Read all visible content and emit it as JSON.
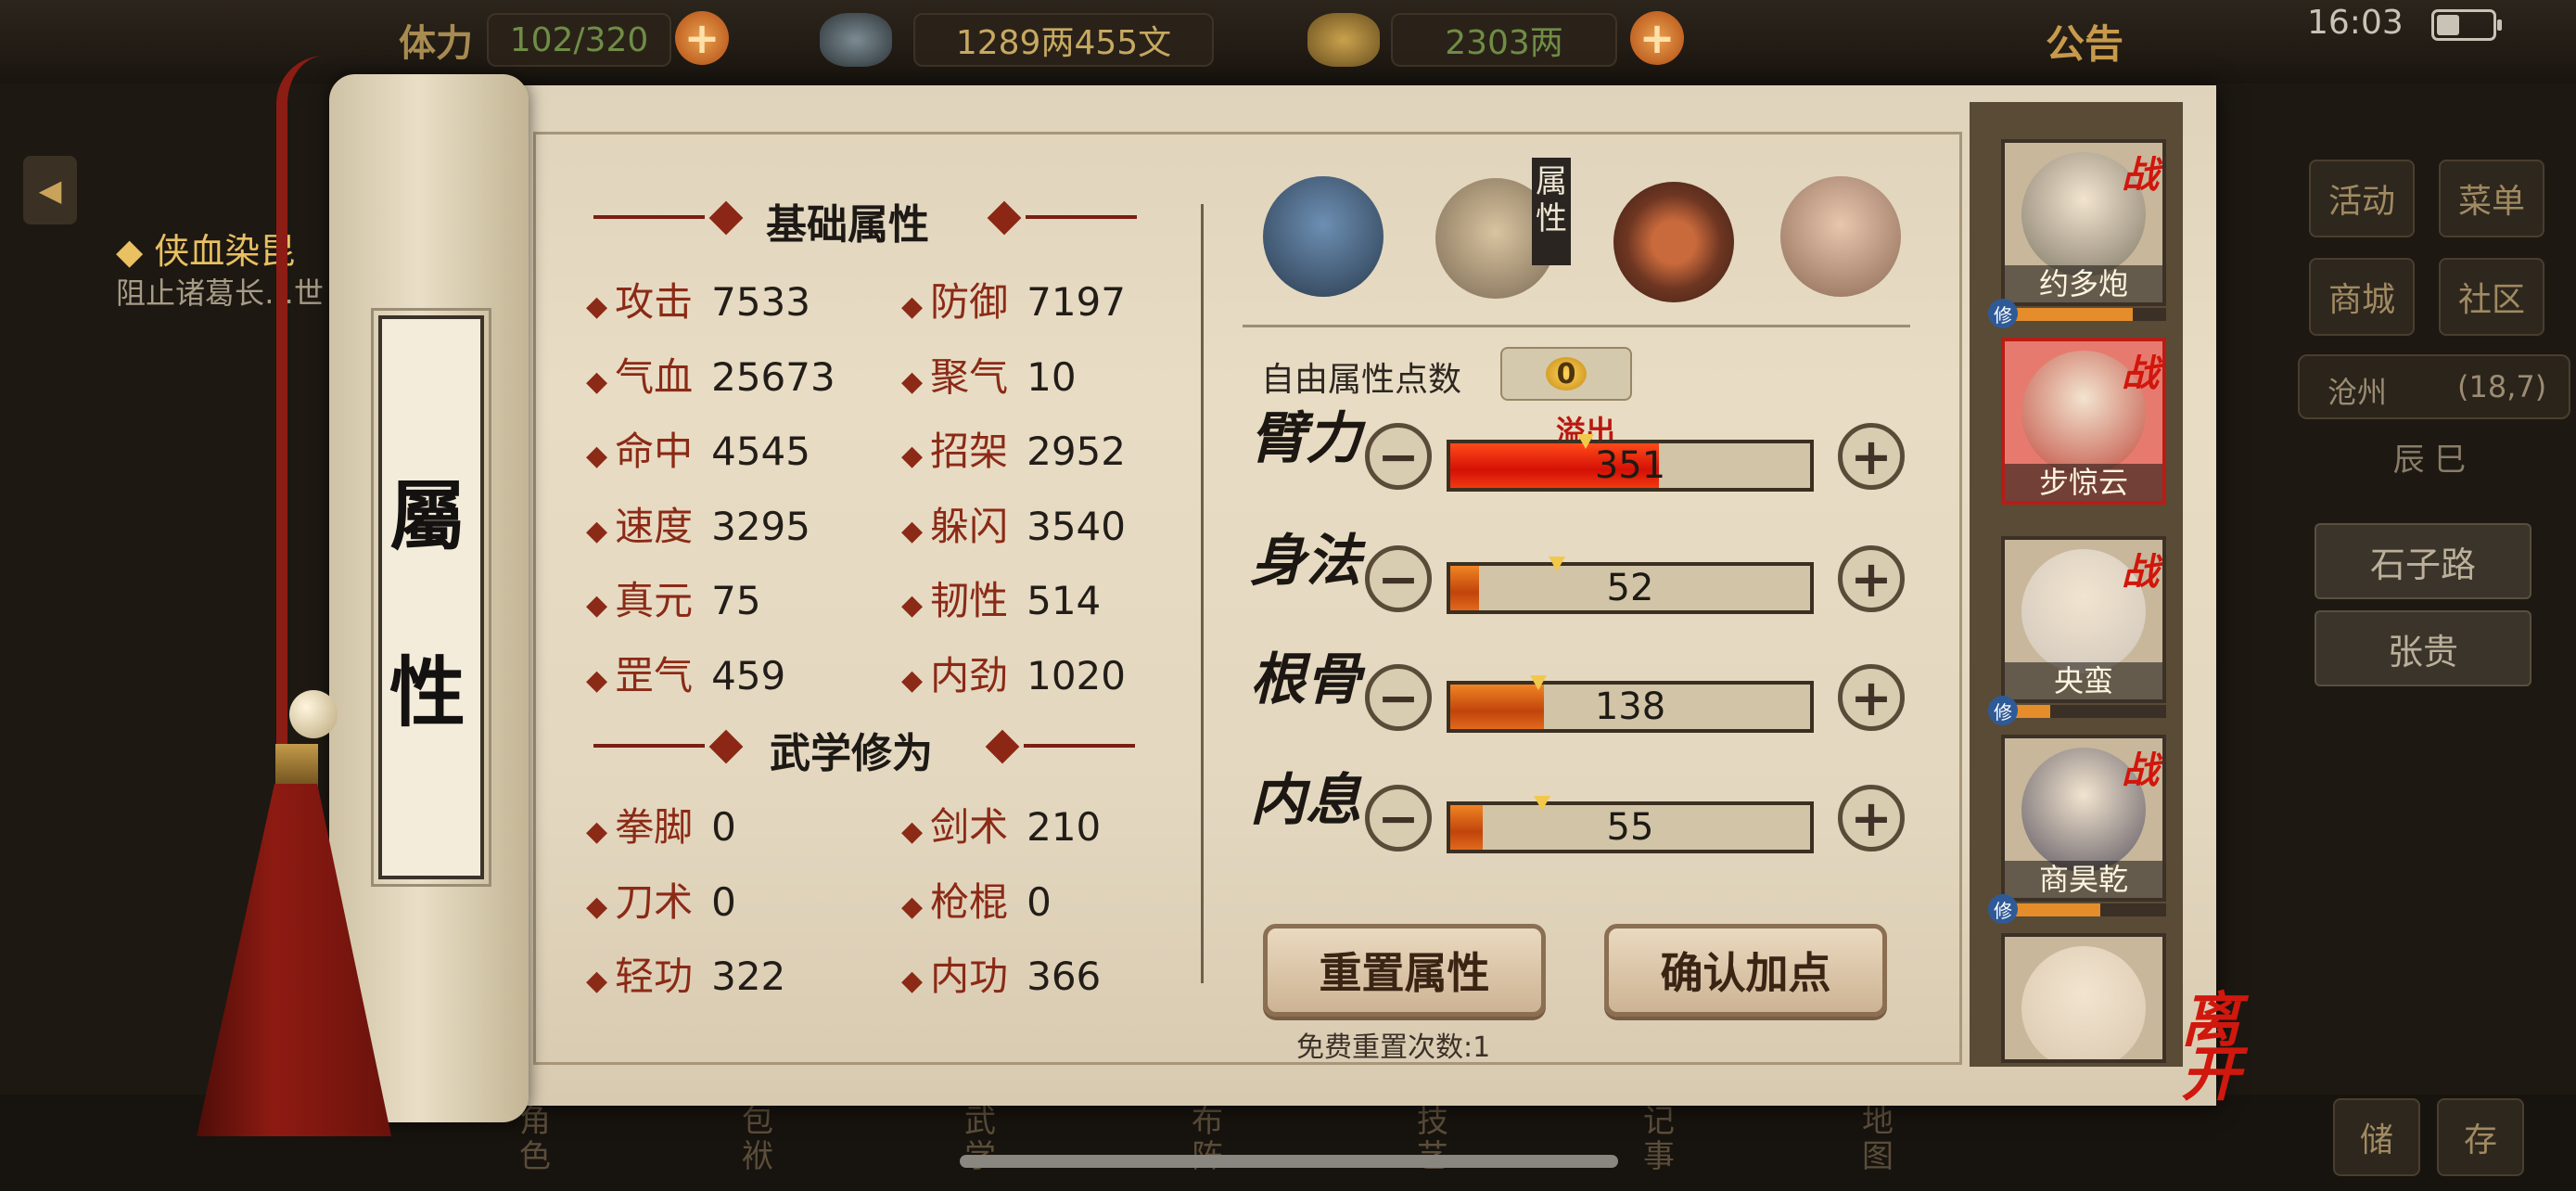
{
  "hud": {
    "stamina_label": "体力",
    "stamina_value": "102/320",
    "silver": "1289两455文",
    "gold": "2303两",
    "announcement": "公告",
    "time": "16:03"
  },
  "background": {
    "quest_title": "◆ 侠血染昆",
    "quest_desc": "阻止诸葛长…世",
    "right_menu": [
      "活动",
      "菜单",
      "商城",
      "社区"
    ],
    "location": "沧州",
    "coords": "(18,7)",
    "time_slot": "辰 巳",
    "npcs": [
      "石子路",
      "张贵"
    ],
    "bottom_nav": [
      "角色",
      "包袱",
      "武学",
      "布阵",
      "技艺",
      "记事",
      "地图"
    ],
    "bottom_right": [
      "储",
      "存"
    ]
  },
  "scroll": {
    "title_chars": [
      "屬",
      "性"
    ]
  },
  "basic": {
    "header": "基础属性",
    "stats": [
      {
        "label": "攻击",
        "value": "7533"
      },
      {
        "label": "防御",
        "value": "7197"
      },
      {
        "label": "气血",
        "value": "25673"
      },
      {
        "label": "聚气",
        "value": "10"
      },
      {
        "label": "命中",
        "value": "4545"
      },
      {
        "label": "招架",
        "value": "2952"
      },
      {
        "label": "速度",
        "value": "3295"
      },
      {
        "label": "躲闪",
        "value": "3540"
      },
      {
        "label": "真元",
        "value": "75"
      },
      {
        "label": "韧性",
        "value": "514"
      },
      {
        "label": "罡气",
        "value": "459"
      },
      {
        "label": "内劲",
        "value": "1020"
      }
    ]
  },
  "martial": {
    "header": "武学修为",
    "stats": [
      {
        "label": "拳脚",
        "value": "0"
      },
      {
        "label": "剑术",
        "value": "210"
      },
      {
        "label": "刀术",
        "value": "0"
      },
      {
        "label": "枪棍",
        "value": "0"
      },
      {
        "label": "轻功",
        "value": "322"
      },
      {
        "label": "内功",
        "value": "366"
      }
    ]
  },
  "tabs": {
    "active_label": "属性",
    "icons": [
      "character-portrait-icon",
      "attribute-scroll-icon",
      "bagua-icon",
      "meridian-body-icon"
    ]
  },
  "points": {
    "free_label": "自由属性点数",
    "free_value": "0",
    "overflow_label": "溢出",
    "attributes": [
      {
        "name": "臂力",
        "value": "351",
        "fill": 0.58,
        "marker": 0.38,
        "overflow": true
      },
      {
        "name": "身法",
        "value": "52",
        "fill": 0.08,
        "marker": 0.3
      },
      {
        "name": "根骨",
        "value": "138",
        "fill": 0.26,
        "marker": 0.25
      },
      {
        "name": "内息",
        "value": "55",
        "fill": 0.09,
        "marker": 0.26
      }
    ],
    "minus_symbol": "−",
    "plus_symbol": "+"
  },
  "actions": {
    "reset_label": "重置属性",
    "confirm_label": "确认加点",
    "reset_note": "免费重置次数:1"
  },
  "party": {
    "battle_mark": "战",
    "xiu_mark": "修",
    "members": [
      {
        "name": "约多炮",
        "xiu": 0.8
      },
      {
        "name": "步惊云",
        "xiu": 0
      },
      {
        "name": "央蛮",
        "xiu": 0.3
      },
      {
        "name": "商昊乾",
        "xiu": 0.6
      },
      {
        "name": ""
      }
    ],
    "leave_label": "离开"
  },
  "colors": {
    "accent_red": "#8b2a16",
    "bar_fill": "#e06a1c",
    "paper": "#e3d7bf"
  }
}
